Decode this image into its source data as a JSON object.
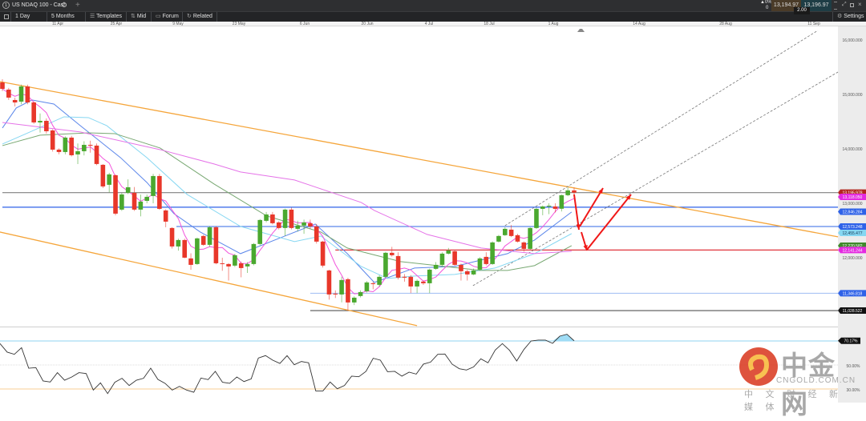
{
  "window": {
    "tab_number": "1",
    "title": "US NDAQ 100 - Cash",
    "new_tab": "+"
  },
  "quote": {
    "change": "▲0%",
    "change_value": "0",
    "bid": "13,194.97",
    "ask": "13,196.97",
    "spread": "2.00",
    "bid_color": "#4a3b28",
    "ask_color": "#1e3d45"
  },
  "toolbar": {
    "interval": "1 Day",
    "range": "5 Months",
    "templates": "Templates",
    "mid": "Mid",
    "forum": "Forum",
    "related": "Related",
    "settings": "Settings"
  },
  "watermark": {
    "brand": "中金网",
    "domain": "CNGOLD.COM.CN",
    "tagline": "中 文 财 经 新 媒 体"
  },
  "chart_data": {
    "type": "candlestick",
    "instrument": "US NDAQ 100 - Cash",
    "x_ticks": [
      "11 Apr",
      "25 Apr",
      "9 May",
      "23 May",
      "6 Jun",
      "20 Jun",
      "4 Jul",
      "18 Jul",
      "1 Aug",
      "14 Aug",
      "28 Aug",
      "11 Sep"
    ],
    "y_ticks": [
      {
        "value": 16000,
        "label": "16,000.000"
      },
      {
        "value": 15000,
        "label": "15,000.000"
      },
      {
        "value": 14000,
        "label": "14,000.000"
      },
      {
        "value": 13000,
        "label": "13,000.000"
      },
      {
        "value": 12000,
        "label": "12,000.000"
      }
    ],
    "ylim": [
      10735,
      16250
    ],
    "colors": {
      "up": "#4aa82f",
      "down": "#e8372a"
    },
    "candles": [
      [
        15221,
        15280,
        15060,
        15103
      ],
      [
        15089,
        15120,
        14900,
        14942
      ],
      [
        14898,
        14940,
        14780,
        14853
      ],
      [
        14868,
        15180,
        14820,
        15147
      ],
      [
        15147,
        15180,
        14820,
        14853
      ],
      [
        14853,
        14870,
        14460,
        14486
      ],
      [
        14486,
        14650,
        14300,
        14515
      ],
      [
        14515,
        14560,
        14280,
        14324
      ],
      [
        14339,
        14360,
        13950,
        13986
      ],
      [
        13986,
        14010,
        13900,
        13942
      ],
      [
        13942,
        14230,
        13900,
        14207
      ],
      [
        14207,
        14240,
        13860,
        13883
      ],
      [
        13898,
        14100,
        13720,
        13957
      ],
      [
        13957,
        14140,
        13880,
        14074
      ],
      [
        14074,
        14150,
        13930,
        14060
      ],
      [
        14060,
        14100,
        13700,
        13722
      ],
      [
        13707,
        13720,
        13280,
        13310
      ],
      [
        13340,
        13560,
        13200,
        13531
      ],
      [
        13516,
        13530,
        12780,
        12810
      ],
      [
        12884,
        13190,
        12860,
        13163
      ],
      [
        13192,
        13440,
        13170,
        13295
      ],
      [
        13192,
        13300,
        12860,
        12884
      ],
      [
        12884,
        13160,
        12760,
        13031
      ],
      [
        13045,
        13160,
        13000,
        13119
      ],
      [
        13134,
        13540,
        13000,
        13501
      ],
      [
        13501,
        13540,
        12880,
        12898
      ],
      [
        12869,
        12890,
        12560,
        12663
      ],
      [
        12546,
        12560,
        12170,
        12207
      ],
      [
        12207,
        12350,
        12130,
        12325
      ],
      [
        12325,
        12350,
        11990,
        12001
      ],
      [
        11987,
        12080,
        11780,
        11869
      ],
      [
        11884,
        12370,
        11870,
        12355
      ],
      [
        12399,
        12420,
        12220,
        12237
      ],
      [
        12237,
        12580,
        12200,
        12560
      ],
      [
        12560,
        12580,
        11880,
        11898
      ],
      [
        11898,
        12000,
        11760,
        11884
      ],
      [
        11884,
        11900,
        11580,
        11840
      ],
      [
        11855,
        12070,
        11830,
        12046
      ],
      [
        11898,
        11930,
        11640,
        11810
      ],
      [
        11840,
        11920,
        11720,
        11884
      ],
      [
        11884,
        12270,
        11860,
        12252
      ],
      [
        12252,
        12710,
        12230,
        12693
      ],
      [
        12678,
        12840,
        12650,
        12795
      ],
      [
        12795,
        12840,
        12610,
        12634
      ],
      [
        12649,
        12670,
        12520,
        12546
      ],
      [
        12546,
        12900,
        12400,
        12884
      ],
      [
        12884,
        12920,
        12520,
        12546
      ],
      [
        12531,
        12680,
        12480,
        12590
      ],
      [
        12590,
        12700,
        12440,
        12649
      ],
      [
        12634,
        12700,
        12530,
        12575
      ],
      [
        12575,
        12620,
        12260,
        12296
      ],
      [
        12296,
        12310,
        11820,
        11855
      ],
      [
        11766,
        11780,
        11230,
        11325
      ],
      [
        11340,
        11400,
        11260,
        11325
      ],
      [
        11325,
        11650,
        11180,
        11590
      ],
      [
        11605,
        11630,
        11028,
        11178
      ],
      [
        11178,
        11290,
        11130,
        11266
      ],
      [
        11296,
        11400,
        11270,
        11369
      ],
      [
        11384,
        11570,
        11360,
        11546
      ],
      [
        11530,
        11560,
        11420,
        11516
      ],
      [
        11502,
        11680,
        11470,
        11649
      ],
      [
        11649,
        12110,
        11630,
        12090
      ],
      [
        12090,
        12200,
        12020,
        12046
      ],
      [
        12031,
        12100,
        11600,
        11634
      ],
      [
        11650,
        11700,
        11560,
        11634
      ],
      [
        11649,
        11680,
        11350,
        11472
      ],
      [
        11472,
        11600,
        11350,
        11575
      ],
      [
        11561,
        11580,
        11500,
        11531
      ],
      [
        11531,
        11800,
        11350,
        11781
      ],
      [
        11796,
        11920,
        11780,
        11869
      ],
      [
        11869,
        12100,
        11850,
        12075
      ],
      [
        12075,
        12180,
        12060,
        12134
      ],
      [
        12119,
        12140,
        11850,
        11869
      ],
      [
        11869,
        11890,
        11580,
        11752
      ],
      [
        11752,
        11780,
        11580,
        11693
      ],
      [
        11693,
        11800,
        11680,
        11766
      ],
      [
        11781,
        12010,
        11760,
        11987
      ],
      [
        12016,
        12100,
        11860,
        11884
      ],
      [
        11884,
        12300,
        11870,
        12281
      ],
      [
        12296,
        12420,
        12280,
        12399
      ],
      [
        12414,
        12560,
        12400,
        12531
      ],
      [
        12516,
        12600,
        12380,
        12399
      ],
      [
        12414,
        12440,
        12280,
        12296
      ],
      [
        12281,
        12300,
        12110,
        12163
      ],
      [
        12163,
        12560,
        12140,
        12546
      ],
      [
        12546,
        12920,
        12530,
        12898
      ],
      [
        12898,
        12960,
        12780,
        12942
      ],
      [
        12942,
        13000,
        12800,
        12955
      ],
      [
        12942,
        13000,
        12830,
        12898
      ],
      [
        12900,
        13160,
        12850,
        13149
      ],
      [
        13149,
        13290,
        13130,
        13237
      ],
      [
        13237,
        13290,
        13120,
        13196
      ]
    ],
    "moving_averages": [
      {
        "color": "#5b86ea",
        "points": [
          [
            0,
            14383
          ],
          [
            2.2,
            14751
          ],
          [
            4.7,
            14898
          ],
          [
            8.2,
            14824
          ],
          [
            12.4,
            14427
          ],
          [
            18.8,
            13839
          ],
          [
            23,
            13383
          ],
          [
            27.3,
            12810
          ],
          [
            31.5,
            12472
          ],
          [
            37.9,
            12075
          ],
          [
            44.3,
            12369
          ],
          [
            49.8,
            12619
          ],
          [
            54.9,
            12075
          ],
          [
            59.2,
            11546
          ],
          [
            65.6,
            11810
          ],
          [
            72,
            11840
          ],
          [
            80.4,
            12075
          ],
          [
            84.7,
            12325
          ],
          [
            90.6,
            12840
          ]
        ]
      },
      {
        "color": "#86d7f2",
        "points": [
          [
            0,
            14089
          ],
          [
            3.8,
            14280
          ],
          [
            9.8,
            14589
          ],
          [
            13.7,
            14574
          ],
          [
            16.6,
            14427
          ],
          [
            23,
            13839
          ],
          [
            29.4,
            13163
          ],
          [
            37.9,
            12575
          ],
          [
            46.5,
            12296
          ],
          [
            50.7,
            12399
          ],
          [
            57.1,
            11840
          ],
          [
            61.3,
            11619
          ],
          [
            65.6,
            11664
          ],
          [
            72,
            11693
          ],
          [
            78.4,
            11810
          ],
          [
            84.7,
            12075
          ],
          [
            90.6,
            12443
          ]
        ]
      },
      {
        "color": "#78a872",
        "points": [
          [
            0,
            14060
          ],
          [
            6,
            14251
          ],
          [
            13.7,
            14295
          ],
          [
            17.9,
            14280
          ],
          [
            25.1,
            14016
          ],
          [
            33.7,
            13354
          ],
          [
            42.1,
            12766
          ],
          [
            50.7,
            12472
          ],
          [
            54.9,
            12178
          ],
          [
            63.4,
            11928
          ],
          [
            76.2,
            11766
          ],
          [
            80.4,
            11766
          ],
          [
            84.7,
            11855
          ],
          [
            90.6,
            12222
          ]
        ]
      },
      {
        "color": "#e573e8",
        "points": [
          [
            0,
            14486
          ],
          [
            12.4,
            14310
          ],
          [
            25.1,
            13986
          ],
          [
            33.7,
            13722
          ],
          [
            37.9,
            13575
          ],
          [
            46.5,
            13428
          ],
          [
            57.1,
            13016
          ],
          [
            59.2,
            12869
          ],
          [
            67.6,
            12428
          ],
          [
            76.2,
            12178
          ],
          [
            84.7,
            12075
          ],
          [
            90.6,
            12119
          ]
        ]
      }
    ],
    "fast_ma_color": "#f255dc",
    "horizontal_levels": [
      {
        "price": 13195.978,
        "color": "#808080",
        "from_bar": 0
      },
      {
        "price": 12928,
        "color": "#2f62e8",
        "from_bar": 0
      },
      {
        "price": 12573.248,
        "color": "#5b86ea",
        "from_bar": 27.7
      },
      {
        "price": 12141.244,
        "color": "#e0343c",
        "from_bar": 53
      },
      {
        "price": 11346.818,
        "color": "#a9c4f5",
        "from_bar": 49
      },
      {
        "price": 11028.522,
        "color": "#555555",
        "from_bar": 49
      }
    ],
    "price_labels": [
      {
        "price": 13195.978,
        "text": "13,195.978",
        "bg": "#b3261e",
        "fg": "#ffffff"
      },
      {
        "price": 13118.05,
        "text": "13,118.050",
        "bg": "#e42ae0",
        "fg": "#ffffff"
      },
      {
        "price": 12846.284,
        "text": "12,846.284",
        "bg": "#2f62e8",
        "fg": "#ffffff"
      },
      {
        "price": 12573.248,
        "text": "12,573.248",
        "bg": "#2f62e8",
        "fg": "#ffffff"
      },
      {
        "price": 12455.477,
        "text": "12,455.477",
        "bg": "#86d7f2",
        "fg": "#1a3a55"
      },
      {
        "price": 12220.582,
        "text": "12,220.582",
        "bg": "#3f8a2a",
        "fg": "#ffffff"
      },
      {
        "price": 12141.244,
        "text": "12,141.244",
        "bg": "#e42ae0",
        "fg": "#ffffff"
      },
      {
        "price": 11346.818,
        "text": "11,346.818",
        "bg": "#2f62e8",
        "fg": "#ffffff"
      },
      {
        "price": 11028.522,
        "text": "11,028.522",
        "bg": "#111111",
        "fg": "#ffffff"
      }
    ],
    "trendlines": [
      {
        "style": "solid",
        "color": "#f5a53a",
        "from": [
          -0.4,
          15236
        ],
        "to": [
          133,
          12384
        ]
      },
      {
        "style": "solid",
        "color": "#f5a53a",
        "from": [
          -0.4,
          12472
        ],
        "to": [
          66,
          10752
        ]
      },
      {
        "style": "dashed",
        "color": "#777777",
        "from": [
          74.9,
          11487
        ],
        "to": [
          133,
          15412
        ]
      },
      {
        "style": "dashed",
        "color": "#777777",
        "from": [
          80,
          12590
        ],
        "to": [
          129.8,
          16176
        ]
      }
    ],
    "rsi": {
      "levels": [
        {
          "value": 70,
          "color": "#8fd3f0"
        },
        {
          "value": 50,
          "color": "#bbbbbb"
        },
        {
          "value": 30,
          "color": "#f8cf95"
        }
      ],
      "level_labels": [
        "50.00%",
        "30.00%"
      ],
      "last_label": "70.17%",
      "ylim": [
        18.7,
        81.3
      ],
      "values": [
        67.8,
        60.7,
        58.9,
        64.4,
        47.3,
        47.8,
        36.7,
        35.8,
        43.6,
        37.3,
        40,
        43.6,
        42.9,
        29.1,
        35.1,
        26.2,
        35.6,
        38.9,
        32.9,
        37.3,
        38.9,
        47.3,
        38,
        34.7,
        29.1,
        32.2,
        29.1,
        27.3,
        39.1,
        37.8,
        44.7,
        35.6,
        34.7,
        40,
        36.2,
        38.4,
        55.8,
        57.8,
        54,
        51.3,
        57.8,
        50.2,
        52.9,
        51.8,
        28.4,
        28.4,
        35.8,
        30.2,
        32.9,
        40.7,
        40.2,
        44.7,
        55.6,
        54,
        44.4,
        44.7,
        40.7,
        44,
        42.4,
        50.7,
        52.4,
        58.9,
        59.1,
        50.7,
        46.9,
        45.8,
        48.4,
        55.1,
        51.8,
        62.4,
        67.8,
        62.2,
        53.3,
        62.9,
        70,
        70.7,
        70.7,
        68,
        74,
        75.6,
        70.17
      ]
    }
  }
}
